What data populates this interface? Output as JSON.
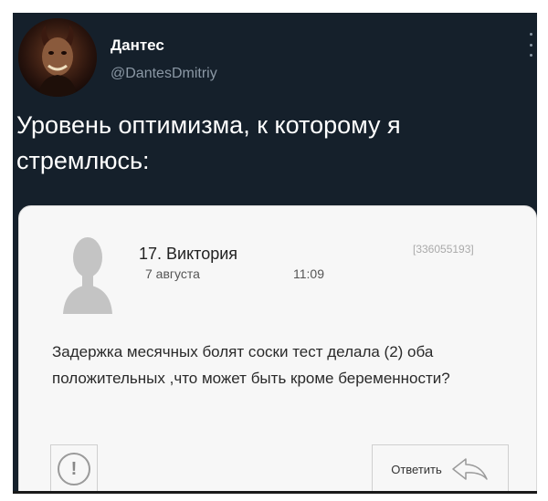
{
  "tweet": {
    "display_name": "Дантес",
    "handle": "@DantesDmitriy",
    "text": "Уровень оптимизма, к которому я стремлюсь:"
  },
  "embedded_post": {
    "number_and_name": "17. Виктория",
    "date": "7 августа",
    "time": "11:09",
    "post_id": "[336055193]",
    "body": "Задержка месячных болят соски тест делала (2) оба положительных ,что может быть кроме беременности?",
    "report_symbol": "!",
    "reply_label": "Ответить"
  },
  "icons": {
    "avatar": "devil-avatar-icon",
    "more": "more-vertical-icon",
    "user": "user-placeholder-icon",
    "report": "exclamation-circle-icon",
    "reply": "reply-arrow-icon"
  },
  "colors": {
    "tweet_background": "#15202b",
    "tweet_text": "#ffffff",
    "handle_text": "#8b98a5",
    "card_background": "#f7f7f7"
  }
}
